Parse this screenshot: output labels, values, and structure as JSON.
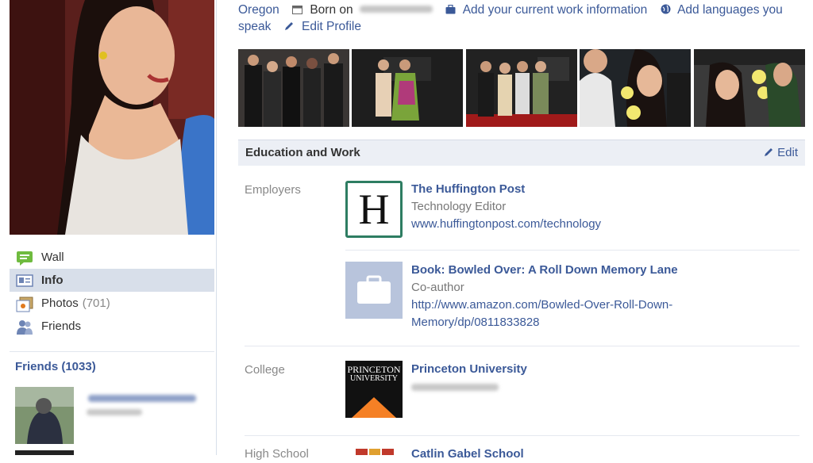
{
  "profile": {
    "location": "Oregon",
    "born_label": "Born on",
    "add_work": "Add your current work information",
    "add_languages": "Add languages you speak",
    "edit_profile": "Edit Profile"
  },
  "nav": {
    "wall": "Wall",
    "info": "Info",
    "photos": "Photos",
    "photos_count": "(701)",
    "friends": "Friends"
  },
  "friends_box": {
    "title": "Friends (1033)"
  },
  "education_work": {
    "title": "Education and Work",
    "edit": "Edit",
    "employers_label": "Employers",
    "employers": [
      {
        "name": "The Huffington Post",
        "role": "Technology Editor",
        "url": "www.huffingtonpost.com/technology",
        "logo_letter": "H"
      },
      {
        "name": "Book: Bowled Over: A Roll Down Memory Lane",
        "role": "Co-author",
        "url_line1": "http://www.amazon.com/Bowled-Over-Roll-Down-",
        "url_line2": "Memory/dp/0811833828"
      }
    ],
    "college_label": "College",
    "college": {
      "name": "Princeton University",
      "logo_line1": "PRINCETON",
      "logo_line2": "UNIVERSITY"
    },
    "highschool_label": "High School",
    "highschool": {
      "name": "Catlin Gabel School"
    }
  },
  "colors": {
    "link": "#3b5998",
    "nav_active_bg": "#d8dfea",
    "section_bg": "#eceff5",
    "huffpost_green": "#2e7d62",
    "princeton_orange": "#f58025"
  }
}
